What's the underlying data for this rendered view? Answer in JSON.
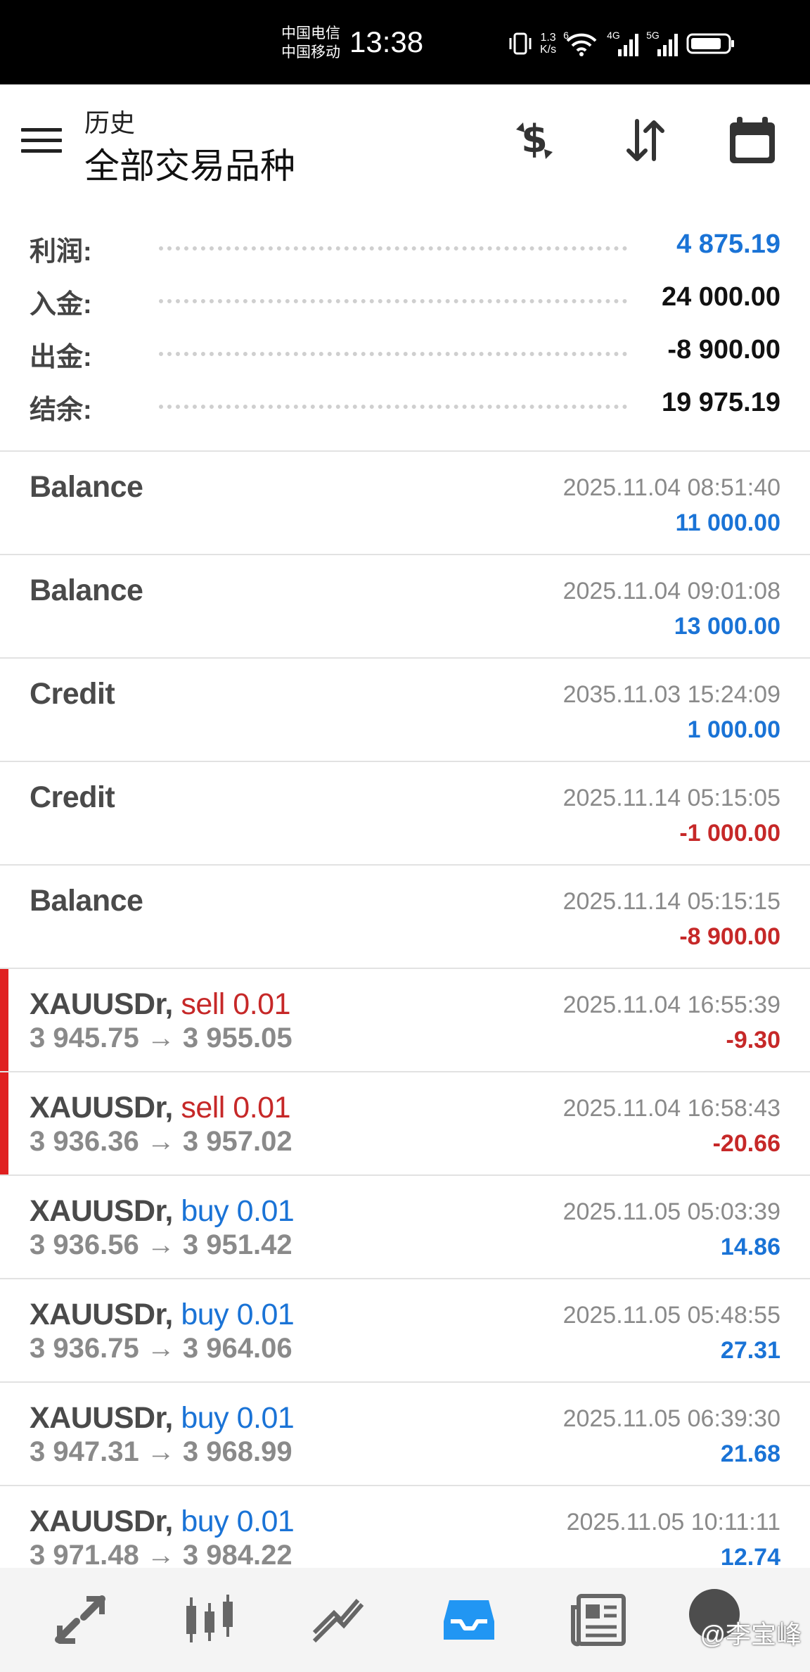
{
  "status_bar": {
    "carrier_1": "中国电信",
    "carrier_2": "中国移动",
    "time": "13:38",
    "speed_value": "1.3",
    "speed_unit": "K/s",
    "net1": "4G",
    "net2": "5G",
    "wifi_badge": "6"
  },
  "header": {
    "subtitle": "历史",
    "title": "全部交易品种",
    "icons": [
      "menu-icon",
      "currency-exchange-icon",
      "sort-icon",
      "calendar-icon"
    ]
  },
  "summary": [
    {
      "label": "利润:",
      "value": "4 875.19",
      "color": "#1a73d6"
    },
    {
      "label": "入金:",
      "value": "24 000.00",
      "color": "#111111"
    },
    {
      "label": "出金:",
      "value": "-8 900.00",
      "color": "#111111"
    },
    {
      "label": "结余:",
      "value": "19 975.19",
      "color": "#111111"
    }
  ],
  "history": [
    {
      "label": "Balance",
      "time": "2025.11.04 08:51:40",
      "amount": "11 000.00",
      "sign": "pos"
    },
    {
      "label": "Balance",
      "time": "2025.11.04 09:01:08",
      "amount": "13 000.00",
      "sign": "pos"
    },
    {
      "label": "Credit",
      "time": "2035.11.03 15:24:09",
      "amount": "1 000.00",
      "sign": "pos"
    },
    {
      "label": "Credit",
      "time": "2025.11.14 05:15:05",
      "amount": "-1 000.00",
      "sign": "neg"
    },
    {
      "label": "Balance",
      "time": "2025.11.14 05:15:15",
      "amount": "-8 900.00",
      "sign": "neg"
    },
    {
      "symbol": "XAUUSDr,",
      "direction": "sell 0.01",
      "prices": "3 945.75 → 3 955.05",
      "time": "2025.11.04 16:55:39",
      "amount": "-9.30",
      "sign": "neg"
    },
    {
      "symbol": "XAUUSDr,",
      "direction": "sell 0.01",
      "prices": "3 936.36 → 3 957.02",
      "time": "2025.11.04 16:58:43",
      "amount": "-20.66",
      "sign": "neg"
    },
    {
      "symbol": "XAUUSDr,",
      "direction": "buy 0.01",
      "prices": "3 936.56 → 3 951.42",
      "time": "2025.11.05 05:03:39",
      "amount": "14.86",
      "sign": "pos"
    },
    {
      "symbol": "XAUUSDr,",
      "direction": "buy 0.01",
      "prices": "3 936.75 → 3 964.06",
      "time": "2025.11.05 05:48:55",
      "amount": "27.31",
      "sign": "pos"
    },
    {
      "symbol": "XAUUSDr,",
      "direction": "buy 0.01",
      "prices": "3 947.31 → 3 968.99",
      "time": "2025.11.05 06:39:30",
      "amount": "21.68",
      "sign": "pos"
    },
    {
      "symbol": "XAUUSDr,",
      "direction": "buy 0.01",
      "prices": "3 971.48 → 3 984.22",
      "time": "2025.11.05 10:11:11",
      "amount": "12.74",
      "sign": "pos"
    }
  ],
  "bottom_nav": {
    "items": [
      "quotes-icon",
      "chart-icon",
      "trade-icon",
      "history-icon",
      "news-icon"
    ],
    "active_color": "#2196f3",
    "watermark": "@李宝峰"
  }
}
